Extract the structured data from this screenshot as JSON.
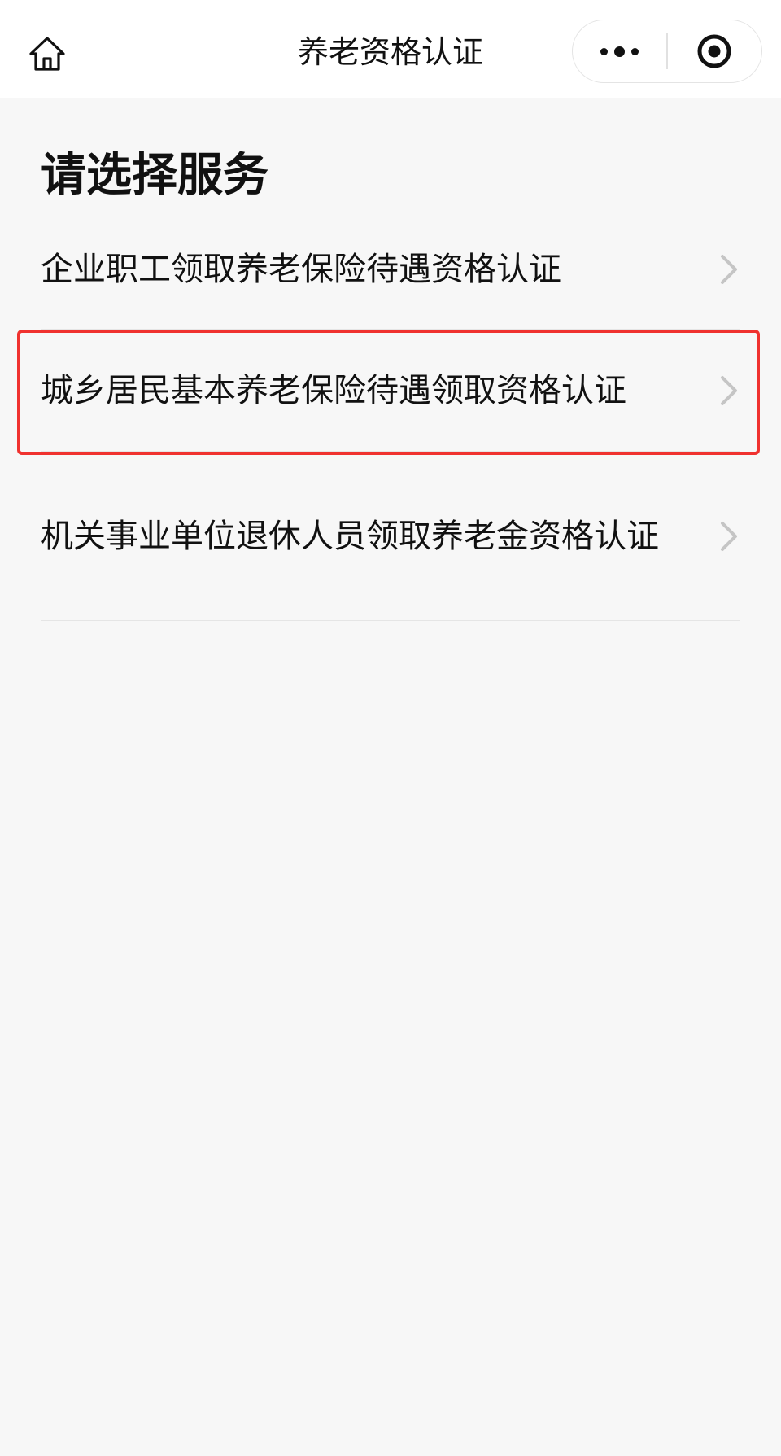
{
  "nav": {
    "title": "养老资格认证",
    "home_icon": "home-icon",
    "more_icon": "more-dots-icon",
    "close_icon": "target-circle-icon"
  },
  "page": {
    "title": "请选择服务"
  },
  "services": [
    {
      "label": "企业职工领取养老保险待遇资格认证"
    },
    {
      "label": "城乡居民基本养老保险待遇领取资格认证"
    },
    {
      "label": "机关事业单位退休人员领取养老金资格认证"
    }
  ],
  "colors": {
    "highlight_border": "#f0322f",
    "background": "#f7f7f7",
    "nav_background": "#ffffff",
    "chevron": "#c5c5c5"
  }
}
